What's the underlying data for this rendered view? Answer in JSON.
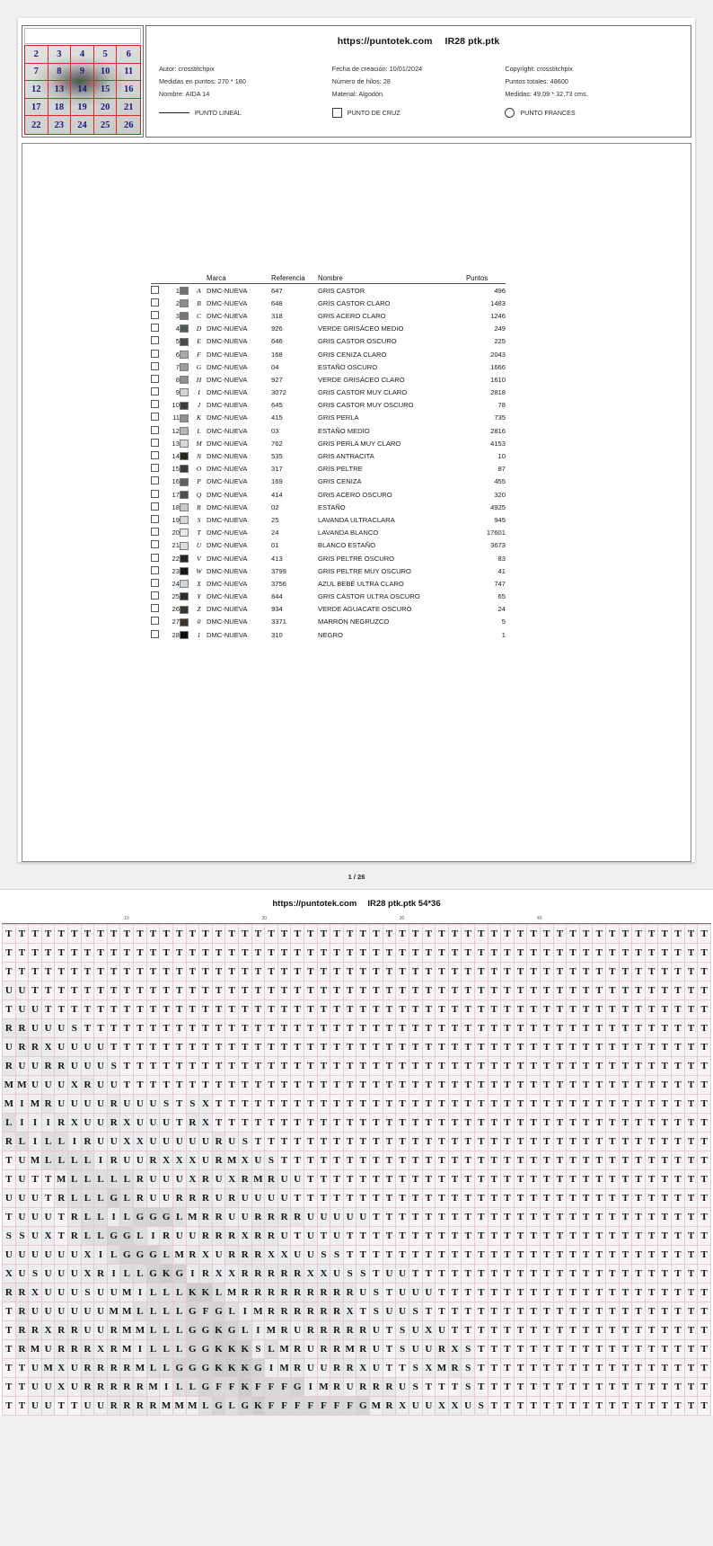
{
  "page1": {
    "thumbnail": {
      "name": "pattern-thumbnail",
      "cells": [
        "2",
        "3",
        "4",
        "5",
        "6",
        "7",
        "8",
        "9",
        "10",
        "11",
        "12",
        "13",
        "14",
        "15",
        "16",
        "17",
        "18",
        "19",
        "20",
        "21",
        "22",
        "23",
        "24",
        "25",
        "26"
      ]
    },
    "header": {
      "site": "https://puntotek.com",
      "file": "IR28 ptk.ptk",
      "fields": [
        "Autor: crosstitchpix",
        "Fecha de creación: 10/01/2024",
        "Copyright: crosstitchpix",
        "Medidas en puntos: 270 * 180",
        "Número de hilos: 28",
        "Puntos totales: 48600",
        "Nombre: AIDA 14",
        "Material: Algodón.",
        "Medidas: 49,09 * 32,73 cms."
      ],
      "legend": [
        {
          "icon": "line-icon",
          "label": "PUNTO LINEAL"
        },
        {
          "icon": "square-icon",
          "label": "PUNTO DE CRUZ"
        },
        {
          "icon": "circle-icon",
          "label": "PUNTO FRANCES"
        }
      ]
    },
    "color_table": {
      "headers": {
        "marca": "Marca",
        "referencia": "Referencia",
        "nombre": "Nombre",
        "puntos": "Puntos"
      },
      "rows": [
        {
          "n": "1",
          "color": "#6f7270",
          "sym": "A",
          "marca": "DMC-NUEVA",
          "ref": "647",
          "name": "GRIS CASTOR",
          "pts": "496"
        },
        {
          "n": "2",
          "color": "#8a8d88",
          "sym": "B",
          "marca": "DMC-NUEVA",
          "ref": "648",
          "name": "GRIS CASTOR CLARO",
          "pts": "1483"
        },
        {
          "n": "3",
          "color": "#757775",
          "sym": "C",
          "marca": "DMC-NUEVA",
          "ref": "318",
          "name": "GRIS ACERO CLARO",
          "pts": "1246"
        },
        {
          "n": "4",
          "color": "#4e5c56",
          "sym": "D",
          "marca": "DMC-NUEVA",
          "ref": "926",
          "name": "VERDE GRISÁCEO MEDIO",
          "pts": "249"
        },
        {
          "n": "5",
          "color": "#4a4c49",
          "sym": "E",
          "marca": "DMC-NUEVA",
          "ref": "646",
          "name": "GRIS CASTOR OSCURO",
          "pts": "225"
        },
        {
          "n": "6",
          "color": "#a9aba8",
          "sym": "F",
          "marca": "DMC-NUEVA",
          "ref": "168",
          "name": "GRIS CENIZA CLARO",
          "pts": "2043"
        },
        {
          "n": "7",
          "color": "#9b9e9a",
          "sym": "G",
          "marca": "DMC-NUEVA",
          "ref": "04",
          "name": "ESTAÑO OSCURO",
          "pts": "1666"
        },
        {
          "n": "8",
          "color": "#8e918c",
          "sym": "H",
          "marca": "DMC-NUEVA",
          "ref": "927",
          "name": "VERDE GRISÁCEO CLARO",
          "pts": "1610"
        },
        {
          "n": "9",
          "color": "#d4d5d1",
          "sym": "I",
          "marca": "DMC-NUEVA",
          "ref": "3072",
          "name": "GRIS CASTOR MUY CLARO",
          "pts": "2818"
        },
        {
          "n": "10",
          "color": "#3b3d3a",
          "sym": "J",
          "marca": "DMC-NUEVA",
          "ref": "645",
          "name": "GRIS CASTOR MUY OSCURO",
          "pts": "78"
        },
        {
          "n": "11",
          "color": "#8d8f8c",
          "sym": "K",
          "marca": "DMC-NUEVA",
          "ref": "415",
          "name": "GRIS PERLA",
          "pts": "735"
        },
        {
          "n": "12",
          "color": "#b5b7b3",
          "sym": "L",
          "marca": "DMC-NUEVA",
          "ref": "03",
          "name": "ESTAÑO MEDIO",
          "pts": "2816"
        },
        {
          "n": "13",
          "color": "#d9dad6",
          "sym": "M",
          "marca": "DMC-NUEVA",
          "ref": "762",
          "name": "GRIS PERLA MUY CLARO",
          "pts": "4153"
        },
        {
          "n": "14",
          "color": "#25281f",
          "sym": "N",
          "marca": "DMC-NUEVA",
          "ref": "535",
          "name": "GRIS ANTRACITA",
          "pts": "10"
        },
        {
          "n": "15",
          "color": "#3a3c38",
          "sym": "O",
          "marca": "DMC-NUEVA",
          "ref": "317",
          "name": "GRIS PELTRE",
          "pts": "87"
        },
        {
          "n": "16",
          "color": "#5e605d",
          "sym": "P",
          "marca": "DMC-NUEVA",
          "ref": "169",
          "name": "GRIS CENIZA",
          "pts": "455"
        },
        {
          "n": "17",
          "color": "#4f514e",
          "sym": "Q",
          "marca": "DMC-NUEVA",
          "ref": "414",
          "name": "GRIS ACERO OSCURO",
          "pts": "320"
        },
        {
          "n": "18",
          "color": "#c9cac6",
          "sym": "R",
          "marca": "DMC-NUEVA",
          "ref": "02",
          "name": "ESTAÑO",
          "pts": "4925"
        },
        {
          "n": "19",
          "color": "#d9d6dd",
          "sym": "S",
          "marca": "DMC-NUEVA",
          "ref": "25",
          "name": "LAVANDA ULTRACLARA",
          "pts": "945"
        },
        {
          "n": "20",
          "color": "#eae6ec",
          "sym": "T",
          "marca": "DMC-NUEVA",
          "ref": "24",
          "name": "LAVANDA BLANCO",
          "pts": "17601"
        },
        {
          "n": "21",
          "color": "#dcdcd8",
          "sym": "U",
          "marca": "DMC-NUEVA",
          "ref": "01",
          "name": "BLANCO ESTAÑO",
          "pts": "3673"
        },
        {
          "n": "22",
          "color": "#23241f",
          "sym": "V",
          "marca": "DMC-NUEVA",
          "ref": "413",
          "name": "GRIS PELTRE OSCURO",
          "pts": "83"
        },
        {
          "n": "23",
          "color": "#141414",
          "sym": "W",
          "marca": "DMC-NUEVA",
          "ref": "3799",
          "name": "GRIS PELTRE MUY OSCURO",
          "pts": "41"
        },
        {
          "n": "24",
          "color": "#cdd6dd",
          "sym": "X",
          "marca": "DMC-NUEVA",
          "ref": "3756",
          "name": "AZUL BEBÉ ULTRA CLARO",
          "pts": "747"
        },
        {
          "n": "25",
          "color": "#2e2f2c",
          "sym": "Y",
          "marca": "DMC-NUEVA",
          "ref": "844",
          "name": "GRIS CASTOR ULTRA OSCURO",
          "pts": "65"
        },
        {
          "n": "26",
          "color": "#313a2c",
          "sym": "Z",
          "marca": "DMC-NUEVA",
          "ref": "934",
          "name": "VERDE AGUACATE OSCURO",
          "pts": "24"
        },
        {
          "n": "27",
          "color": "#3d342e",
          "sym": "0",
          "marca": "DMC-NUEVA",
          "ref": "3371",
          "name": "MARRÓN NEGRUZCO",
          "pts": "5"
        },
        {
          "n": "28",
          "color": "#0c0c0c",
          "sym": "1",
          "marca": "DMC-NUEVA",
          "ref": "310",
          "name": "NEGRO",
          "pts": "1"
        }
      ]
    },
    "footer": "1 / 26"
  },
  "page2": {
    "title": {
      "site": "https://puntotek.com",
      "file": "IR28 ptk.ptk 54*36"
    },
    "ruler_ticks": [
      {
        "label": "10",
        "pct": 17.6
      },
      {
        "label": "20",
        "pct": 37.0
      },
      {
        "label": "30",
        "pct": 56.4
      },
      {
        "label": "40",
        "pct": 75.8
      }
    ],
    "grid": {
      "cols": 54,
      "major_every": 10,
      "rows": [
        "TTTTTTTTTTTTTTTTTTTTTTTTTTTTTTTTTTTTTTTTTTTTTTTTTTTTTT",
        "TTTTTTTTTTTTTTTTTTTTTTTTTTTTTTTTTTTTTTTTTTTTTTTTTTTTTT",
        "TTTTTTTTTTTTTTTTTTTTTTTTTTTTTTTTTTTTTTTTTTTTTTTTTTTTTT",
        "UUTTTTTTTTTTTTTTTTTTTTTTTTTTTTTTTTTTTTTTTTTTTTTTTTTTTT",
        "TUUTTTTTTTTTTTTTTTTTTTTTTTTTTTTTTTTTTTTTTTTTTTTTTTTTTT",
        "RRUUUSTTTTTTTTTTTTTTTTTTTTTTTTTTTTTTTTTTTTTTTTTTTTTTTT",
        "URRXUUUUTTTTTTTTTTTTTTTTTTTTTTTTTTTTTTTTTTTTTTTTTTTTTT",
        "RUURRUUUSTTTTTTTTTTTTTTTTTTTTTTTTTTTTTTTTTTTTTTTTTTTTT",
        "MMUUUXRUUTTTTTTTTTTTTTTTTTTTTTTTTTTTTTTTTTTTTTTTTTTTTT",
        "MIMRUUUURUUUSTSXTTTTTTTTTTTTTTTTTTTTTTTTTTTTTTTTTTTTTT",
        "LIIIRXUURXUUUTRXTTTTTTTTTTTTTTTTTTTTTTTTTTTTTTTTTTTTTT",
        "RLILLIRUUXXUUUUURUSTTTTTTTTTTTTTTTTTTTTTTTTTTTTTTTTTTT",
        "TUMLLLLIRUURXXXURMXUSTTTTTTTTTTTTTTTTTTTTTTTTTTTTTTTTT",
        "TUTTMLLLLLRUUUXRUXRMRUUTTTTTTTTTTTTTTTTTTTTTTTTTTTTTTT",
        "UUUTRLLLGLRUURRRURUUUUTTTTTTTTTTTTTTTTTTTTTTTTTTTTTTTT",
        "TUUUTRLLILGGGLMRRUURRRRUUUUUTTTTTTTTTTTTTTTTTTTTTTTTTT",
        "SSUXTRLLGGLIRUURRRXRRUTUTUTTTTTTTTTTTTTTTTTTTTTTTTTTTT",
        "UUUUUUXILGGGLMRXURRRXXUUSSTTTTTTTTTTTTTTTTTTTTTTTTTTTT",
        "XUSUUUXRILLGKGIRXXRRRRRXXUSSTUUTTTTTTTTTTTTTTTTTTTTTTT",
        "RRXUUUSUUMILLLKKLMRRRRRRRRRUSTUUUTTTTTTTTTTTTTTTTTTTTT",
        "TRUUUUUUMMLLLLGFGLIMRRRRRRXTSUUSTTTTTTTTTTTTTTTTTTTTTT",
        "TRRXRRUURMMLLLGGKGLIMRURRRRRUTSUXUTTTTTTTTTTTTTTTTTTTT",
        "TRMURRRXRMILLLGGKKKSLMRURRMRUTSUURXSTTTTTTTTTTTTTTTTTT",
        "TTUMXURRRRMLLGGGKKKGIMRUURRXUTTSXMRSTTTTTTTTTTTTTTTTTT",
        "TTUUXURRRRRMILLGFFKFFFGIMRURRRUSTTTSTTTTTTTTTTTTTTTTTT",
        "TTUUTTUURRRRMMMLGLGKFFFFFFFGMRXUUXXUSTTTTTTTTTTTTTTTTT"
      ]
    }
  }
}
